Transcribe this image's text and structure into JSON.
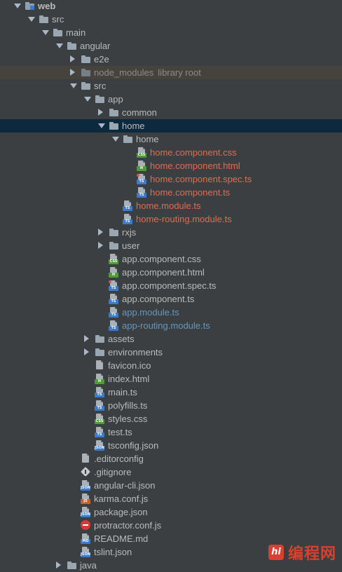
{
  "tree": [
    {
      "label": "web",
      "kind": "folder-module",
      "arrow": "open",
      "depth": 0,
      "color": "default",
      "bold": true
    },
    {
      "label": "src",
      "kind": "folder",
      "arrow": "open",
      "depth": 1,
      "color": "default"
    },
    {
      "label": "main",
      "kind": "folder",
      "arrow": "open",
      "depth": 2,
      "color": "default"
    },
    {
      "label": "angular",
      "kind": "folder",
      "arrow": "open",
      "depth": 3,
      "color": "default"
    },
    {
      "label": "e2e",
      "kind": "folder",
      "arrow": "closed",
      "depth": 4,
      "color": "default"
    },
    {
      "label": "node_modules",
      "kind": "folder-dim",
      "arrow": "closed",
      "depth": 4,
      "color": "dim",
      "hint": "library root",
      "lib": true
    },
    {
      "label": "src",
      "kind": "folder",
      "arrow": "open",
      "depth": 4,
      "color": "default"
    },
    {
      "label": "app",
      "kind": "folder",
      "arrow": "open",
      "depth": 5,
      "color": "default"
    },
    {
      "label": "common",
      "kind": "folder",
      "arrow": "closed",
      "depth": 6,
      "color": "default"
    },
    {
      "label": "home",
      "kind": "folder",
      "arrow": "open",
      "depth": 6,
      "color": "default",
      "selected": true
    },
    {
      "label": "home",
      "kind": "folder",
      "arrow": "open",
      "depth": 7,
      "color": "default"
    },
    {
      "label": "home.component.css",
      "kind": "file",
      "tag": "CSS",
      "depth": 8,
      "color": "new"
    },
    {
      "label": "home.component.html",
      "kind": "file",
      "tag": "H",
      "depth": 8,
      "color": "new"
    },
    {
      "label": "home.component.spec.ts",
      "kind": "file",
      "tag": "TS",
      "spec": true,
      "depth": 8,
      "color": "new"
    },
    {
      "label": "home.component.ts",
      "kind": "file",
      "tag": "TS",
      "depth": 8,
      "color": "new"
    },
    {
      "label": "home.module.ts",
      "kind": "file",
      "tag": "TS",
      "depth": 7,
      "color": "new"
    },
    {
      "label": "home-routing.module.ts",
      "kind": "file",
      "tag": "TS",
      "depth": 7,
      "color": "new"
    },
    {
      "label": "rxjs",
      "kind": "folder",
      "arrow": "closed",
      "depth": 6,
      "color": "default"
    },
    {
      "label": "user",
      "kind": "folder",
      "arrow": "closed",
      "depth": 6,
      "color": "default"
    },
    {
      "label": "app.component.css",
      "kind": "file",
      "tag": "CSS",
      "depth": 6,
      "color": "default"
    },
    {
      "label": "app.component.html",
      "kind": "file",
      "tag": "H",
      "depth": 6,
      "color": "default"
    },
    {
      "label": "app.component.spec.ts",
      "kind": "file",
      "tag": "TS",
      "spec": true,
      "depth": 6,
      "color": "default"
    },
    {
      "label": "app.component.ts",
      "kind": "file",
      "tag": "TS",
      "depth": 6,
      "color": "default"
    },
    {
      "label": "app.module.ts",
      "kind": "file",
      "tag": "TS",
      "depth": 6,
      "color": "modified"
    },
    {
      "label": "app-routing.module.ts",
      "kind": "file",
      "tag": "TS",
      "depth": 6,
      "color": "modified"
    },
    {
      "label": "assets",
      "kind": "folder",
      "arrow": "closed",
      "depth": 5,
      "color": "default"
    },
    {
      "label": "environments",
      "kind": "folder",
      "arrow": "closed",
      "depth": 5,
      "color": "default"
    },
    {
      "label": "favicon.ico",
      "kind": "file",
      "tag": "",
      "depth": 5,
      "color": "default"
    },
    {
      "label": "index.html",
      "kind": "file",
      "tag": "H",
      "depth": 5,
      "color": "default"
    },
    {
      "label": "main.ts",
      "kind": "file",
      "tag": "TS",
      "depth": 5,
      "color": "default"
    },
    {
      "label": "polyfills.ts",
      "kind": "file",
      "tag": "TS",
      "depth": 5,
      "color": "default"
    },
    {
      "label": "styles.css",
      "kind": "file",
      "tag": "CSS",
      "depth": 5,
      "color": "default"
    },
    {
      "label": "test.ts",
      "kind": "file",
      "tag": "TS",
      "depth": 5,
      "color": "default"
    },
    {
      "label": "tsconfig.json",
      "kind": "file",
      "tag": "JSON",
      "depth": 5,
      "color": "default"
    },
    {
      "label": ".editorconfig",
      "kind": "file",
      "tag": "",
      "depth": 4,
      "color": "default"
    },
    {
      "label": ".gitignore",
      "kind": "git",
      "depth": 4,
      "color": "default"
    },
    {
      "label": "angular-cli.json",
      "kind": "file",
      "tag": "JSON",
      "depth": 4,
      "color": "default"
    },
    {
      "label": "karma.conf.js",
      "kind": "file",
      "tag": "JS",
      "depth": 4,
      "color": "default"
    },
    {
      "label": "package.json",
      "kind": "file",
      "tag": "JSON",
      "depth": 4,
      "color": "default"
    },
    {
      "label": "protractor.conf.js",
      "kind": "protractor",
      "depth": 4,
      "color": "default"
    },
    {
      "label": "README.md",
      "kind": "file",
      "tag": "MD",
      "depth": 4,
      "color": "default"
    },
    {
      "label": "tslint.json",
      "kind": "file",
      "tag": "JSON",
      "depth": 4,
      "color": "default"
    },
    {
      "label": "java",
      "kind": "folder",
      "arrow": "closed",
      "depth": 3,
      "color": "default"
    }
  ],
  "colors": {
    "background": "#3c3f41",
    "selected": "#0d293e",
    "library_row": "#45433c",
    "default_text": "#bbbbbb",
    "modified_text": "#6897bb",
    "new_text": "#e06c50"
  },
  "watermark": {
    "logo": "hi",
    "text": "编程网"
  }
}
